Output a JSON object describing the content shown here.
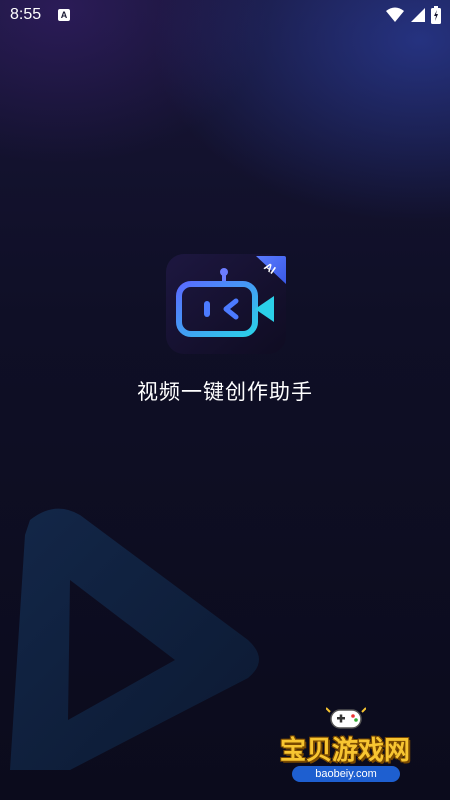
{
  "status_bar": {
    "time": "8:55",
    "notification_icon": "A"
  },
  "splash": {
    "app_name": "视频一键创作助手",
    "logo_badge": "AI"
  },
  "watermark": {
    "title": "宝贝游戏网",
    "url": "baobeiy.com"
  },
  "colors": {
    "accent_blue": "#4a7cff",
    "accent_cyan": "#2bd0e8",
    "watermark_gold": "#f7c531"
  }
}
